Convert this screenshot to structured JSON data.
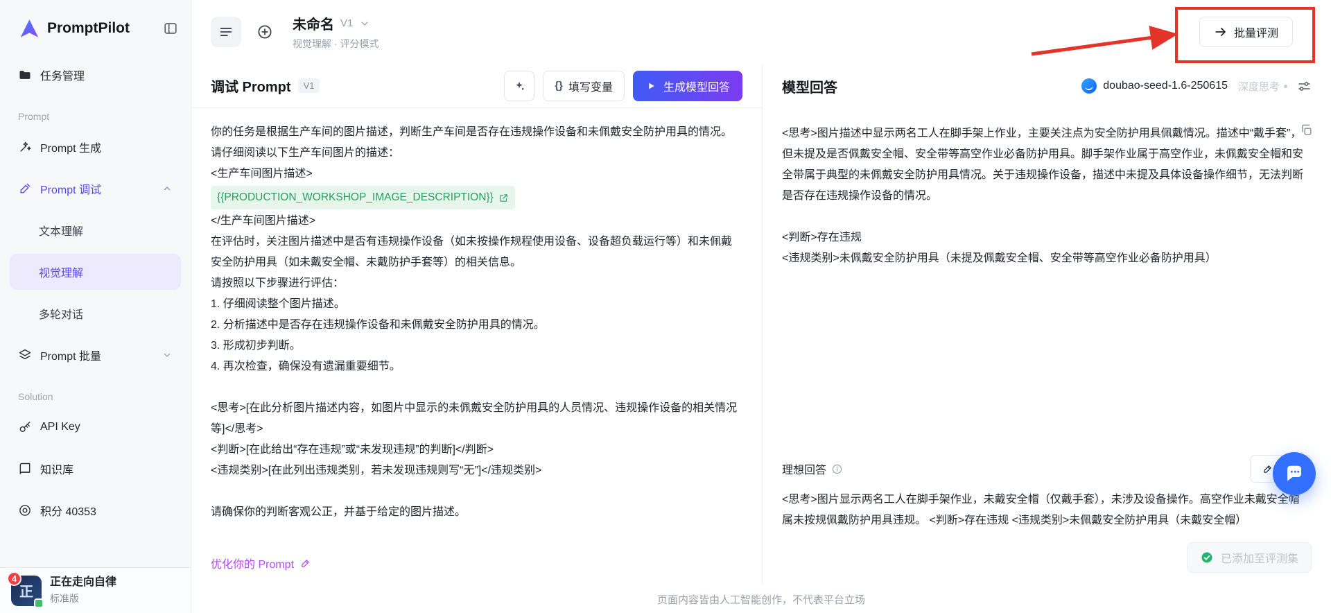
{
  "app": {
    "name": "PromptPilot"
  },
  "sidebar": {
    "task_management": "任务管理",
    "section_prompt": "Prompt",
    "prompt_generate": "Prompt 生成",
    "prompt_debug": "Prompt 调试",
    "submenu": {
      "text": "文本理解",
      "vision": "视觉理解",
      "multi_turn": "多轮对话"
    },
    "prompt_batch": "Prompt 批量",
    "section_solution": "Solution",
    "api_key": "API Key",
    "knowledge_base": "知识库",
    "credits": "积分 40353",
    "user": {
      "name": "正在走向自律",
      "plan": "标准版",
      "badge_count": "4",
      "avatar_char": "正"
    }
  },
  "header": {
    "title": "未命名",
    "version": "V1",
    "subtitle": "视觉理解 · 评分模式",
    "batch_eval_button": "批量评测"
  },
  "debug_panel": {
    "title": "调试 Prompt",
    "version": "V1",
    "braces": "{}",
    "fill_variables_button": "填写变量",
    "generate_button": "生成模型回答",
    "variable": "{{PRODUCTION_WORKSHOP_IMAGE_DESCRIPTION}}",
    "prompt": [
      "你的任务是根据生产车间的图片描述，判断生产车间是否存在违规操作设备和未佩戴安全防护用具的情况。请仔细阅读以下生产车间图片的描述：",
      "<生产车间图片描述>",
      "</生产车间图片描述>",
      "在评估时，关注图片描述中是否有违规操作设备（如未按操作规程使用设备、设备超负载运行等）和未佩戴安全防护用具（如未戴安全帽、未戴防护手套等）的相关信息。",
      "请按照以下步骤进行评估：",
      "1. 仔细阅读整个图片描述。",
      "2. 分析描述中是否存在违规操作设备和未佩戴安全防护用具的情况。",
      "3. 形成初步判断。",
      "4. 再次检查，确保没有遗漏重要细节。",
      "<思考>[在此分析图片描述内容，如图片中显示的未佩戴安全防护用具的人员情况、违规操作设备的相关情况等]</思考>",
      "<判断>[在此给出“存在违规”或“未发现违规”的判断]</判断>",
      "<违规类别>[在此列出违规类别，若未发现违规则写“无”]</违规类别>",
      "请确保你的判断客观公正，并基于给定的图片描述。"
    ],
    "optimize_link": "优化你的 Prompt"
  },
  "answer_panel": {
    "title": "模型回答",
    "model_name": "doubao-seed-1.6-250615",
    "deep_thinking": "深度思考",
    "response": {
      "thinking": "<思考>图片描述中显示两名工人在脚手架上作业，主要关注点为安全防护用具佩戴情况。描述中“戴手套”，但未提及是否佩戴安全帽、安全带等高空作业必备防护用具。脚手架作业属于高空作业，未佩戴安全帽和安全带属于典型的未佩戴安全防护用具情况。关于违规操作设备，描述中未提及具体设备操作细节，无法判断是否存在违规操作设备的情况。",
      "judgment": "<判断>存在违规",
      "category": "<违规类别>未佩戴安全防护用具（未提及佩戴安全帽、安全带等高空作业必备防护用具）"
    },
    "ideal": {
      "label": "理想回答",
      "edit_button": "编辑",
      "text": "<思考>图片显示两名工人在脚手架作业，未戴安全帽（仅戴手套），未涉及设备操作。高空作业未戴安全帽属未按规佩戴防护用具违规。 <判断>存在违规 <违规类别>未佩戴安全防护用具（未戴安全帽）"
    },
    "added_button": "已添加至评测集"
  },
  "footer": {
    "disclaimer": "页面内容皆由人工智能创作，不代表平台立场"
  }
}
